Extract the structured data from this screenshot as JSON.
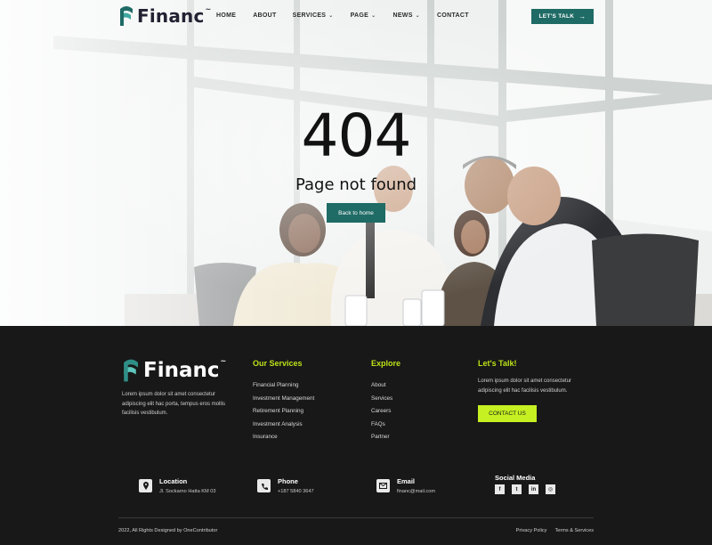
{
  "brand": {
    "name": "Financ",
    "tm": "~",
    "accent": "#1f6b66",
    "lime": "#c6f021",
    "title_green": "#bde318"
  },
  "nav": {
    "items": [
      {
        "label": "HOME",
        "dropdown": false
      },
      {
        "label": "ABOUT",
        "dropdown": false
      },
      {
        "label": "SERVICES",
        "dropdown": true
      },
      {
        "label": "PAGE",
        "dropdown": true
      },
      {
        "label": "NEWS",
        "dropdown": true
      },
      {
        "label": "CONTACT",
        "dropdown": false
      }
    ],
    "cta_label": "LET'S TALK",
    "cta_icon": "arrow-right-icon"
  },
  "error": {
    "code": "404",
    "message": "Page not found",
    "button_label": "Back to home"
  },
  "footer": {
    "description": "Lorem ipsum dolor sit amet consectetur adipiscing elit  hac porta, tempus eros  mollis facilisis vestibulum.",
    "services": {
      "title": "Our Services",
      "items": [
        "Financial Planning",
        "Investment Management",
        "Retirement Planning",
        "Investment Analysis",
        "Insurance"
      ]
    },
    "explore": {
      "title": "Explore",
      "items": [
        "About",
        "Services",
        "Careers",
        "FAQs",
        "Partner"
      ]
    },
    "talk": {
      "title": "Let's Talk!",
      "description": "Lorem ipsum dolor sit amet consectetur adipiscing elit  hac  facilisis vestibulum.",
      "button_label": "CONTACT US"
    },
    "contacts": {
      "location": {
        "title": "Location",
        "text": "Jl. Sockarno  Hatta KM 03",
        "icon": "location-pin-icon"
      },
      "phone": {
        "title": "Phone",
        "text": "+187 5840  3647",
        "icon": "phone-icon"
      },
      "email": {
        "title": "Email",
        "text": "financ@mail.com",
        "icon": "envelope-icon"
      }
    },
    "social": {
      "title": "Social Media",
      "icons": [
        {
          "name": "facebook-icon",
          "glyph": "f"
        },
        {
          "name": "twitter-icon",
          "glyph": "t"
        },
        {
          "name": "linkedin-icon",
          "glyph": "in"
        },
        {
          "name": "instagram-icon",
          "glyph": "◎"
        }
      ]
    },
    "copyright": "2022, All Rights Designed by OneContributor",
    "legal": [
      "Privacy Policy",
      "Terms & Services"
    ]
  }
}
